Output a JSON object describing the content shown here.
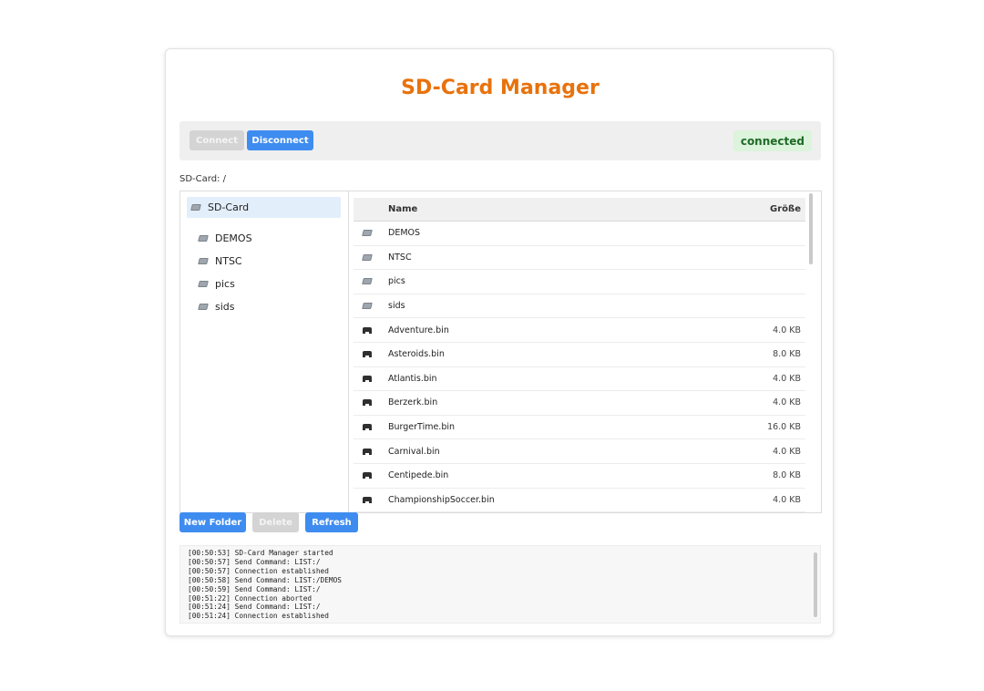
{
  "app": {
    "title": "SD-Card Manager"
  },
  "toolbar": {
    "connect_label": "Connect",
    "disconnect_label": "Disconnect",
    "status": "connected"
  },
  "breadcrumb": "SD-Card: /",
  "tree": {
    "root": "SD-Card",
    "items": [
      {
        "label": "DEMOS"
      },
      {
        "label": "NTSC"
      },
      {
        "label": "pics"
      },
      {
        "label": "sids"
      }
    ]
  },
  "files": {
    "columns": {
      "name": "Name",
      "size": "Größe"
    },
    "rows": [
      {
        "name": "DEMOS",
        "size": "",
        "type": "folder"
      },
      {
        "name": "NTSC",
        "size": "",
        "type": "folder"
      },
      {
        "name": "pics",
        "size": "",
        "type": "folder"
      },
      {
        "name": "sids",
        "size": "",
        "type": "folder"
      },
      {
        "name": "Adventure.bin",
        "size": "4.0 KB",
        "type": "file"
      },
      {
        "name": "Asteroids.bin",
        "size": "8.0 KB",
        "type": "file"
      },
      {
        "name": "Atlantis.bin",
        "size": "4.0 KB",
        "type": "file"
      },
      {
        "name": "Berzerk.bin",
        "size": "4.0 KB",
        "type": "file"
      },
      {
        "name": "BurgerTime.bin",
        "size": "16.0 KB",
        "type": "file"
      },
      {
        "name": "Carnival.bin",
        "size": "4.0 KB",
        "type": "file"
      },
      {
        "name": "Centipede.bin",
        "size": "8.0 KB",
        "type": "file"
      },
      {
        "name": "ChampionshipSoccer.bin",
        "size": "4.0 KB",
        "type": "file"
      }
    ]
  },
  "actions": {
    "new_folder_label": "New Folder",
    "delete_label": "Delete",
    "refresh_label": "Refresh"
  },
  "log": {
    "lines": [
      "[00:50:53] SD-Card Manager started",
      "[00:50:57] Send Command: LIST:/",
      "[00:50:57] Connection established",
      "[00:50:58] Send Command: LIST:/DEMOS",
      "[00:50:59] Send Command: LIST:/",
      "[00:51:22] Connection aborted",
      "[00:51:24] Send Command: LIST:/",
      "[00:51:24] Connection established"
    ]
  },
  "colors": {
    "accent": "#e8720c",
    "primary_button": "#3f8cf0",
    "status_bg": "#dcf3dc",
    "status_text": "#1e6a26"
  }
}
